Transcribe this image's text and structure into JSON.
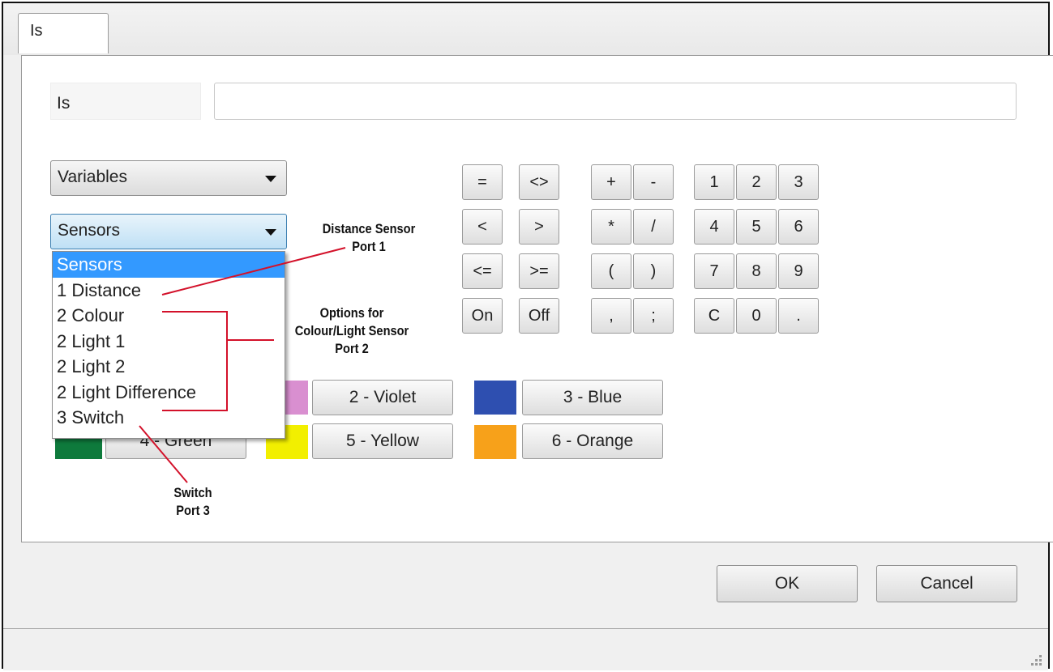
{
  "tab": {
    "label": "Is"
  },
  "name_row": {
    "label": "Is",
    "value": ""
  },
  "variables_combo": {
    "selected": "Variables"
  },
  "sensors_combo": {
    "selected": "Sensors",
    "options": [
      "Sensors",
      "1 Distance",
      "2 Colour",
      "2 Light 1",
      "2 Light 2",
      "2 Light Difference",
      "3 Switch"
    ]
  },
  "keypad": {
    "compare": [
      "=",
      "<>",
      "<",
      ">",
      "<=",
      ">=",
      "On",
      "Off"
    ],
    "ops": [
      "+",
      "-",
      "*",
      "/",
      "(",
      ")",
      ",",
      ";"
    ],
    "digits": [
      "1",
      "2",
      "3",
      "4",
      "5",
      "6",
      "7",
      "8",
      "9",
      "C",
      "0",
      "."
    ]
  },
  "colour_buttons": [
    {
      "label": "4 - Green",
      "color": "#0e7a3c"
    },
    {
      "label": "2 - Violet",
      "color": "#d98fd0"
    },
    {
      "label": "3 - Blue",
      "color": "#2e4fb0"
    },
    {
      "label": "5 - Yellow",
      "color": "#f2ef00"
    },
    {
      "label": "6 - Orange",
      "color": "#f7a11a"
    }
  ],
  "dialog_buttons": {
    "ok": "OK",
    "cancel": "Cancel"
  },
  "annotations": {
    "distance_l1": "Distance Sensor",
    "distance_l2": "Port 1",
    "colour_l1": "Options for",
    "colour_l2": "Colour/Light Sensor",
    "colour_l3": "Port 2",
    "switch_l1": "Switch",
    "switch_l2": "Port 3"
  },
  "callout_color": "#d3112a"
}
